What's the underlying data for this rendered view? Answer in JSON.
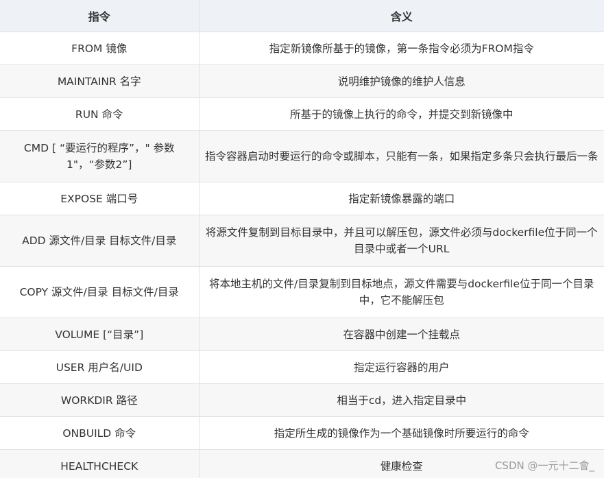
{
  "header": {
    "col1": "指令",
    "col2": "含义"
  },
  "rows": [
    {
      "cmd": "FROM 镜像",
      "desc": "指定新镜像所基于的镜像，第一条指令必须为FROM指令"
    },
    {
      "cmd": "MAINTAINR 名字",
      "desc": "说明维护镜像的维护人信息"
    },
    {
      "cmd": "RUN 命令",
      "desc": "所基于的镜像上执行的命令，并提交到新镜像中"
    },
    {
      "cmd": "CMD [ “要运行的程序”，\" 参数1\"，“参数2”]",
      "desc": "指令容器启动时要运行的命令或脚本，只能有一条，如果指定多条只会执行最后一条"
    },
    {
      "cmd": "EXPOSE 端口号",
      "desc": "指定新镜像暴露的端口"
    },
    {
      "cmd": "ADD 源文件/目录 目标文件/目录",
      "desc": "将源文件复制到目标目录中，并且可以解压包，源文件必须与dockerfile位于同一个目录中或者一个URL"
    },
    {
      "cmd": "COPY 源文件/目录 目标文件/目录",
      "desc": "将本地主机的文件/目录复制到目标地点，源文件需要与dockerfile位于同一个目录中，它不能解压包"
    },
    {
      "cmd": "VOLUME [“目录”]",
      "desc": "在容器中创建一个挂载点"
    },
    {
      "cmd": "USER 用户名/UID",
      "desc": "指定运行容器的用户"
    },
    {
      "cmd": "WORKDIR 路径",
      "desc": "相当于cd，进入指定目录中"
    },
    {
      "cmd": "ONBUILD 命令",
      "desc": "指定所生成的镜像作为一个基础镜像时所要运行的命令"
    },
    {
      "cmd": "HEALTHCHECK",
      "desc": "健康检查"
    }
  ],
  "watermark": "CSDN @一元十二會_"
}
